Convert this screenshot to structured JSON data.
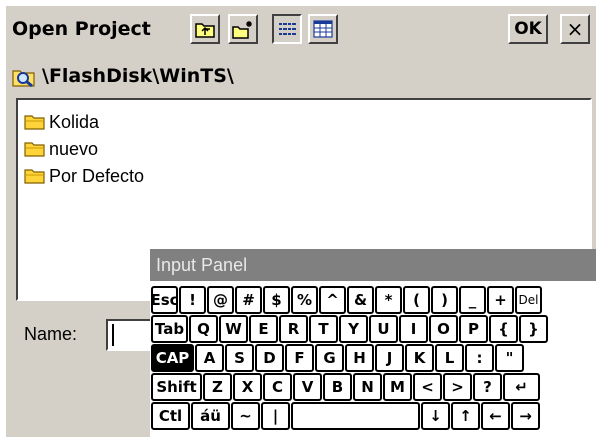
{
  "dialog": {
    "title": "Open Project",
    "ok_label": "OK",
    "close_label": "×",
    "toolbar_icons": [
      "up-folder-icon",
      "new-folder-icon",
      "list-view-icon",
      "details-view-icon"
    ]
  },
  "path": {
    "icon": "search-folder-icon",
    "value": "\\FlashDisk\\WinTS\\"
  },
  "files": [
    {
      "name": "Kolida",
      "icon": "folder-icon"
    },
    {
      "name": "nuevo",
      "icon": "folder-icon"
    },
    {
      "name": "Por Defecto",
      "icon": "folder-icon"
    }
  ],
  "name_field": {
    "label": "Name:",
    "value": ""
  },
  "input_panel": {
    "title": "Input Panel",
    "rows": [
      [
        "Esc",
        "!",
        "@",
        "#",
        "$",
        "%",
        "^",
        "&",
        "*",
        "(",
        ")",
        "_",
        "+",
        "Del"
      ],
      [
        "Tab",
        "Q",
        "W",
        "E",
        "R",
        "T",
        "Y",
        "U",
        "I",
        "O",
        "P",
        "{",
        "}"
      ],
      [
        "CAP",
        "A",
        "S",
        "D",
        "F",
        "G",
        "H",
        "J",
        "K",
        "L",
        ":",
        "\""
      ],
      [
        "Shift",
        "Z",
        "X",
        "C",
        "V",
        "B",
        "N",
        "M",
        "<",
        ">",
        "?",
        "↵"
      ],
      [
        "Ctl",
        "áü",
        "~",
        "|",
        "",
        "↓",
        "↑",
        "←",
        "→"
      ]
    ]
  }
}
